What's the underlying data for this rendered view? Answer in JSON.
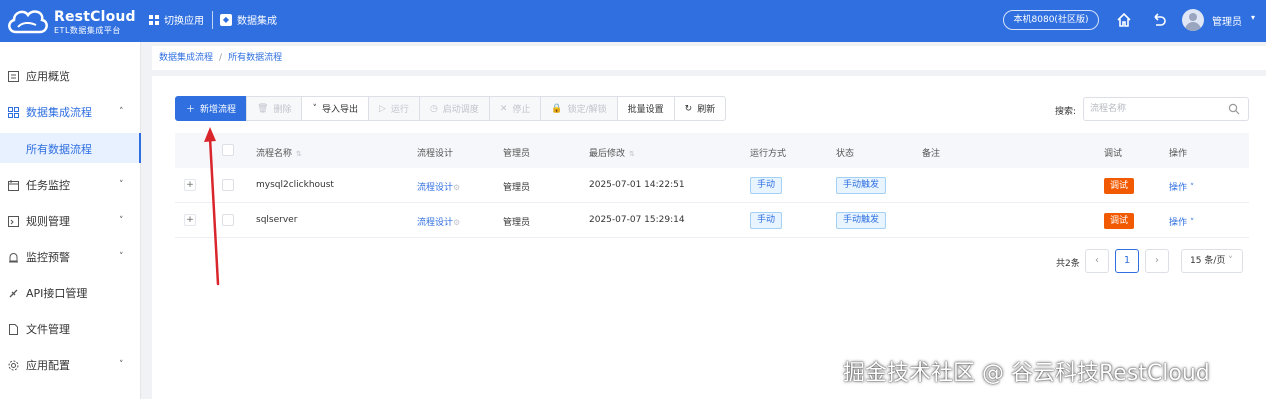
{
  "header": {
    "logo_title": "RestCloud",
    "logo_subtitle": "ETL数据集成平台",
    "switch_app": "切换应用",
    "current_app": "数据集成",
    "env": "本机8080(社区版)",
    "user": "管理员"
  },
  "sidebar": {
    "items": [
      {
        "label": "应用概览",
        "icon": "overview-icon"
      },
      {
        "label": "数据集成流程",
        "icon": "grid-icon",
        "expanded": true
      },
      {
        "label": "所有数据流程",
        "sub": true,
        "active": true
      },
      {
        "label": "任务监控",
        "icon": "calendar-icon"
      },
      {
        "label": "规则管理",
        "icon": "rule-icon"
      },
      {
        "label": "监控预警",
        "icon": "alarm-icon"
      },
      {
        "label": "API接口管理",
        "icon": "api-icon"
      },
      {
        "label": "文件管理",
        "icon": "file-icon"
      },
      {
        "label": "应用配置",
        "icon": "gear-icon"
      }
    ]
  },
  "breadcrumb": [
    "数据集成流程",
    "所有数据流程"
  ],
  "toolbar": {
    "new": "新增流程",
    "delete": "删除",
    "import_export": "导入导出",
    "run": "运行",
    "schedule": "启动调度",
    "stop": "停止",
    "lock": "锁定/解锁",
    "batch": "批量设置",
    "refresh": "刷新"
  },
  "search": {
    "label": "搜索:",
    "placeholder": "流程名称"
  },
  "table": {
    "headers": [
      "流程名称",
      "流程设计",
      "管理员",
      "最后修改",
      "运行方式",
      "状态",
      "备注",
      "调试",
      "操作"
    ],
    "rows": [
      {
        "name": "mysql2clickhoust",
        "design": "流程设计",
        "admin": "管理员",
        "modified": "2025-07-01 14:22:51",
        "run_mode": "手动",
        "status": "手动触发",
        "note": "",
        "debug": "调试",
        "op": "操作"
      },
      {
        "name": "sqlserver",
        "design": "流程设计",
        "admin": "管理员",
        "modified": "2025-07-07 15:29:14",
        "run_mode": "手动",
        "status": "手动触发",
        "note": "",
        "debug": "调试",
        "op": "操作"
      }
    ]
  },
  "pagination": {
    "total": "共2条",
    "current": "1",
    "page_size": "15 条/页"
  },
  "watermark": "掘金技术社区 @ 谷云科技RestCloud",
  "colors": {
    "primary": "#2f6fe0",
    "debug": "#f15a00",
    "annotation": "#d9262c"
  }
}
